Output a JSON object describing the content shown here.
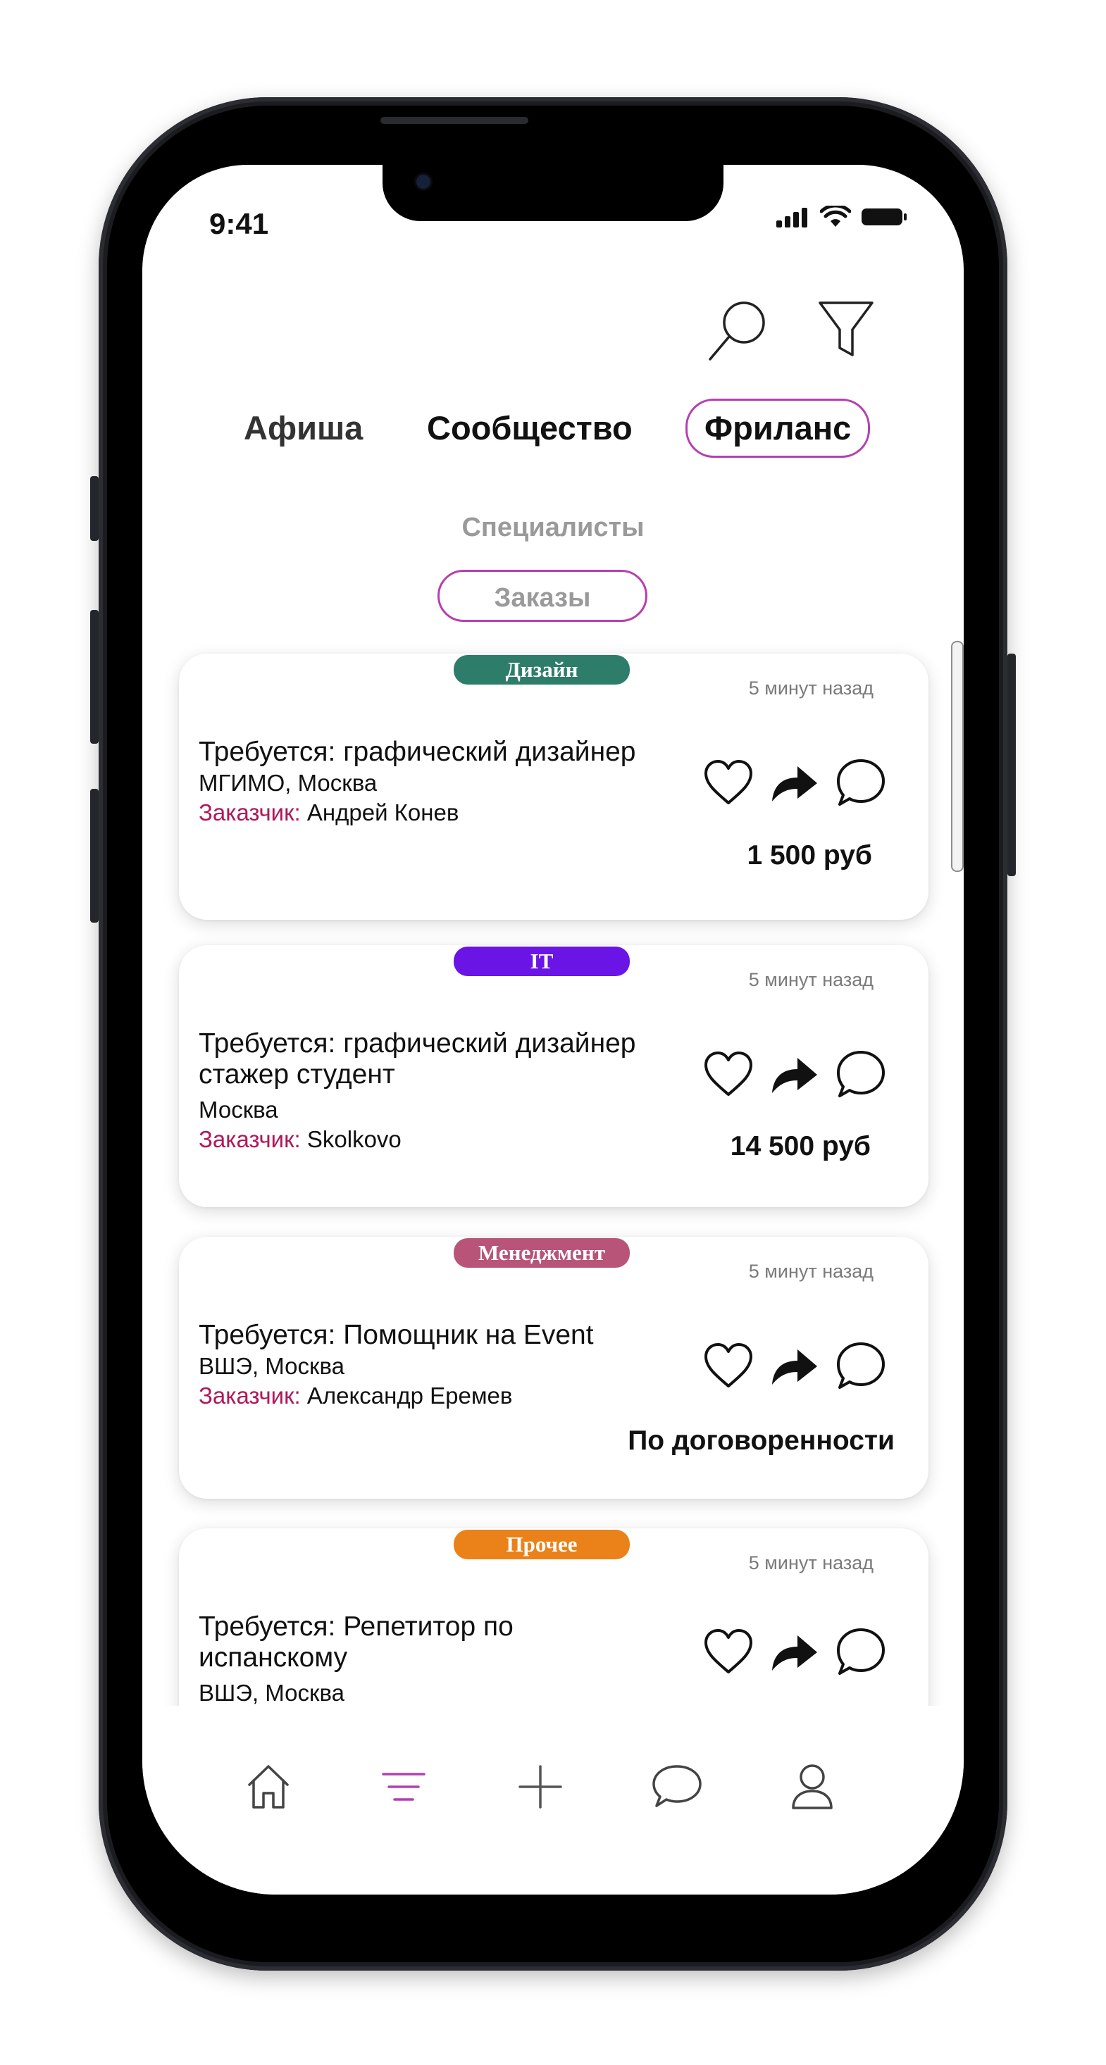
{
  "status_bar": {
    "time": "9:41"
  },
  "header": {
    "icons": [
      "search-icon",
      "filter-icon"
    ]
  },
  "main_tabs": [
    {
      "label": "Афиша",
      "active": false
    },
    {
      "label": "Сообщество",
      "active": false
    },
    {
      "label": "Фриланс",
      "active": true
    }
  ],
  "sub_tabs": [
    {
      "label": "Специалисты",
      "active": false
    },
    {
      "label": "Заказы",
      "active": true
    }
  ],
  "cards": [
    {
      "category": "Дизайн",
      "category_color": "#2e7d6b",
      "time_ago": "5 минут назад",
      "title_lines": [
        "Требуется: графический дизайнер"
      ],
      "location": "МГИМО, Москва",
      "customer_label": "Заказчик:",
      "customer": "Андрей Конев",
      "price": "1 500 руб"
    },
    {
      "category": "IT",
      "category_color": "#6a14e6",
      "time_ago": "5 минут назад",
      "title_lines": [
        "Требуется: графический дизайнер",
        "стажер  студент"
      ],
      "location": "Москва",
      "customer_label": "Заказчик:",
      "customer": "Skolkovo",
      "price": "14 500 руб"
    },
    {
      "category": "Менеджмент",
      "category_color": "#b85478",
      "time_ago": "5 минут назад",
      "title_lines": [
        "Требуется: Помощник на Event"
      ],
      "location": "ВШЭ, Москва",
      "customer_label": "Заказчик:",
      "customer": "Александр Еремев",
      "price": "По договоренности"
    },
    {
      "category": "Прочее",
      "category_color": "#ea8219",
      "time_ago": "5 минут назад",
      "title_lines": [
        "Требуется: Репетитор по",
        "испанскому"
      ],
      "location": "ВШЭ, Москва",
      "customer_label": "",
      "customer": "",
      "price": ""
    }
  ],
  "card_action_icons": [
    "heart-icon",
    "share-icon",
    "comment-icon"
  ],
  "tabbar": {
    "items": [
      "home-icon",
      "feed-icon",
      "add-icon",
      "chat-icon",
      "profile-icon"
    ],
    "active": "feed-icon",
    "active_color": "#b63fb0",
    "inactive_color": "#555555"
  },
  "colors": {
    "accent": "#b63fb0",
    "customer_label": "#b0175a"
  }
}
